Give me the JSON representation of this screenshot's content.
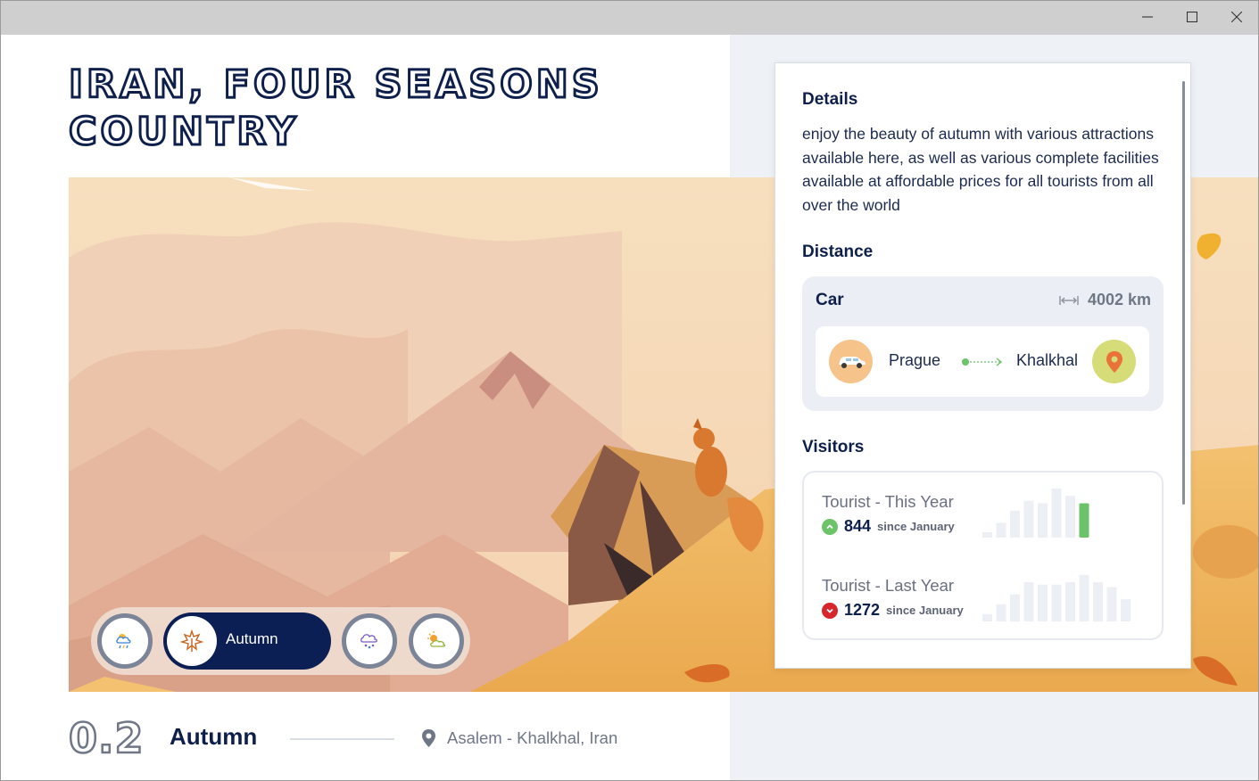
{
  "window": {
    "controls": [
      "minimize",
      "maximize",
      "close"
    ]
  },
  "title": "IRAN, FOUR SEASONS COUNTRY",
  "seasons": {
    "active_label": "Autumn",
    "buttons": [
      {
        "icon": "rain-sun-icon"
      },
      {
        "icon": "autumn-leaf-icon"
      },
      {
        "icon": "snow-cloud-icon"
      },
      {
        "icon": "sun-cloud-icon"
      }
    ]
  },
  "details": {
    "heading": "Details",
    "text": "enjoy the beauty of autumn with various attractions available here, as well as various complete facilities available at affordable prices for all tourists from all over the world"
  },
  "distance": {
    "heading": "Distance",
    "mode": "Car",
    "value": "4002 km",
    "from": "Prague",
    "to": "Khalkhal"
  },
  "visitors": {
    "heading": "Visitors",
    "this_year": {
      "label": "Tourist - This Year",
      "count": "844",
      "since": "since January",
      "trend": "up",
      "bars": [
        0.1,
        0.3,
        0.55,
        0.75,
        0.7,
        1.0,
        0.85,
        0.7
      ],
      "highlight_color": "#6cc36a"
    },
    "last_year": {
      "label": "Tourist - Last Year",
      "count": "1272",
      "since": "since January",
      "trend": "down",
      "bars": [
        0.15,
        0.35,
        0.55,
        0.8,
        0.75,
        0.75,
        0.8,
        0.95,
        0.8,
        0.7,
        0.45,
        0.17
      ],
      "highlight_color": "#d6262b"
    }
  },
  "footer": {
    "number": "0.2",
    "season": "Autumn",
    "location": "Asalem - Khalkhal, Iran"
  },
  "colors": {
    "navy": "#0b1f54",
    "panel_bg": "#eef2f6",
    "up": "#6cc36a",
    "down": "#d6262b"
  }
}
